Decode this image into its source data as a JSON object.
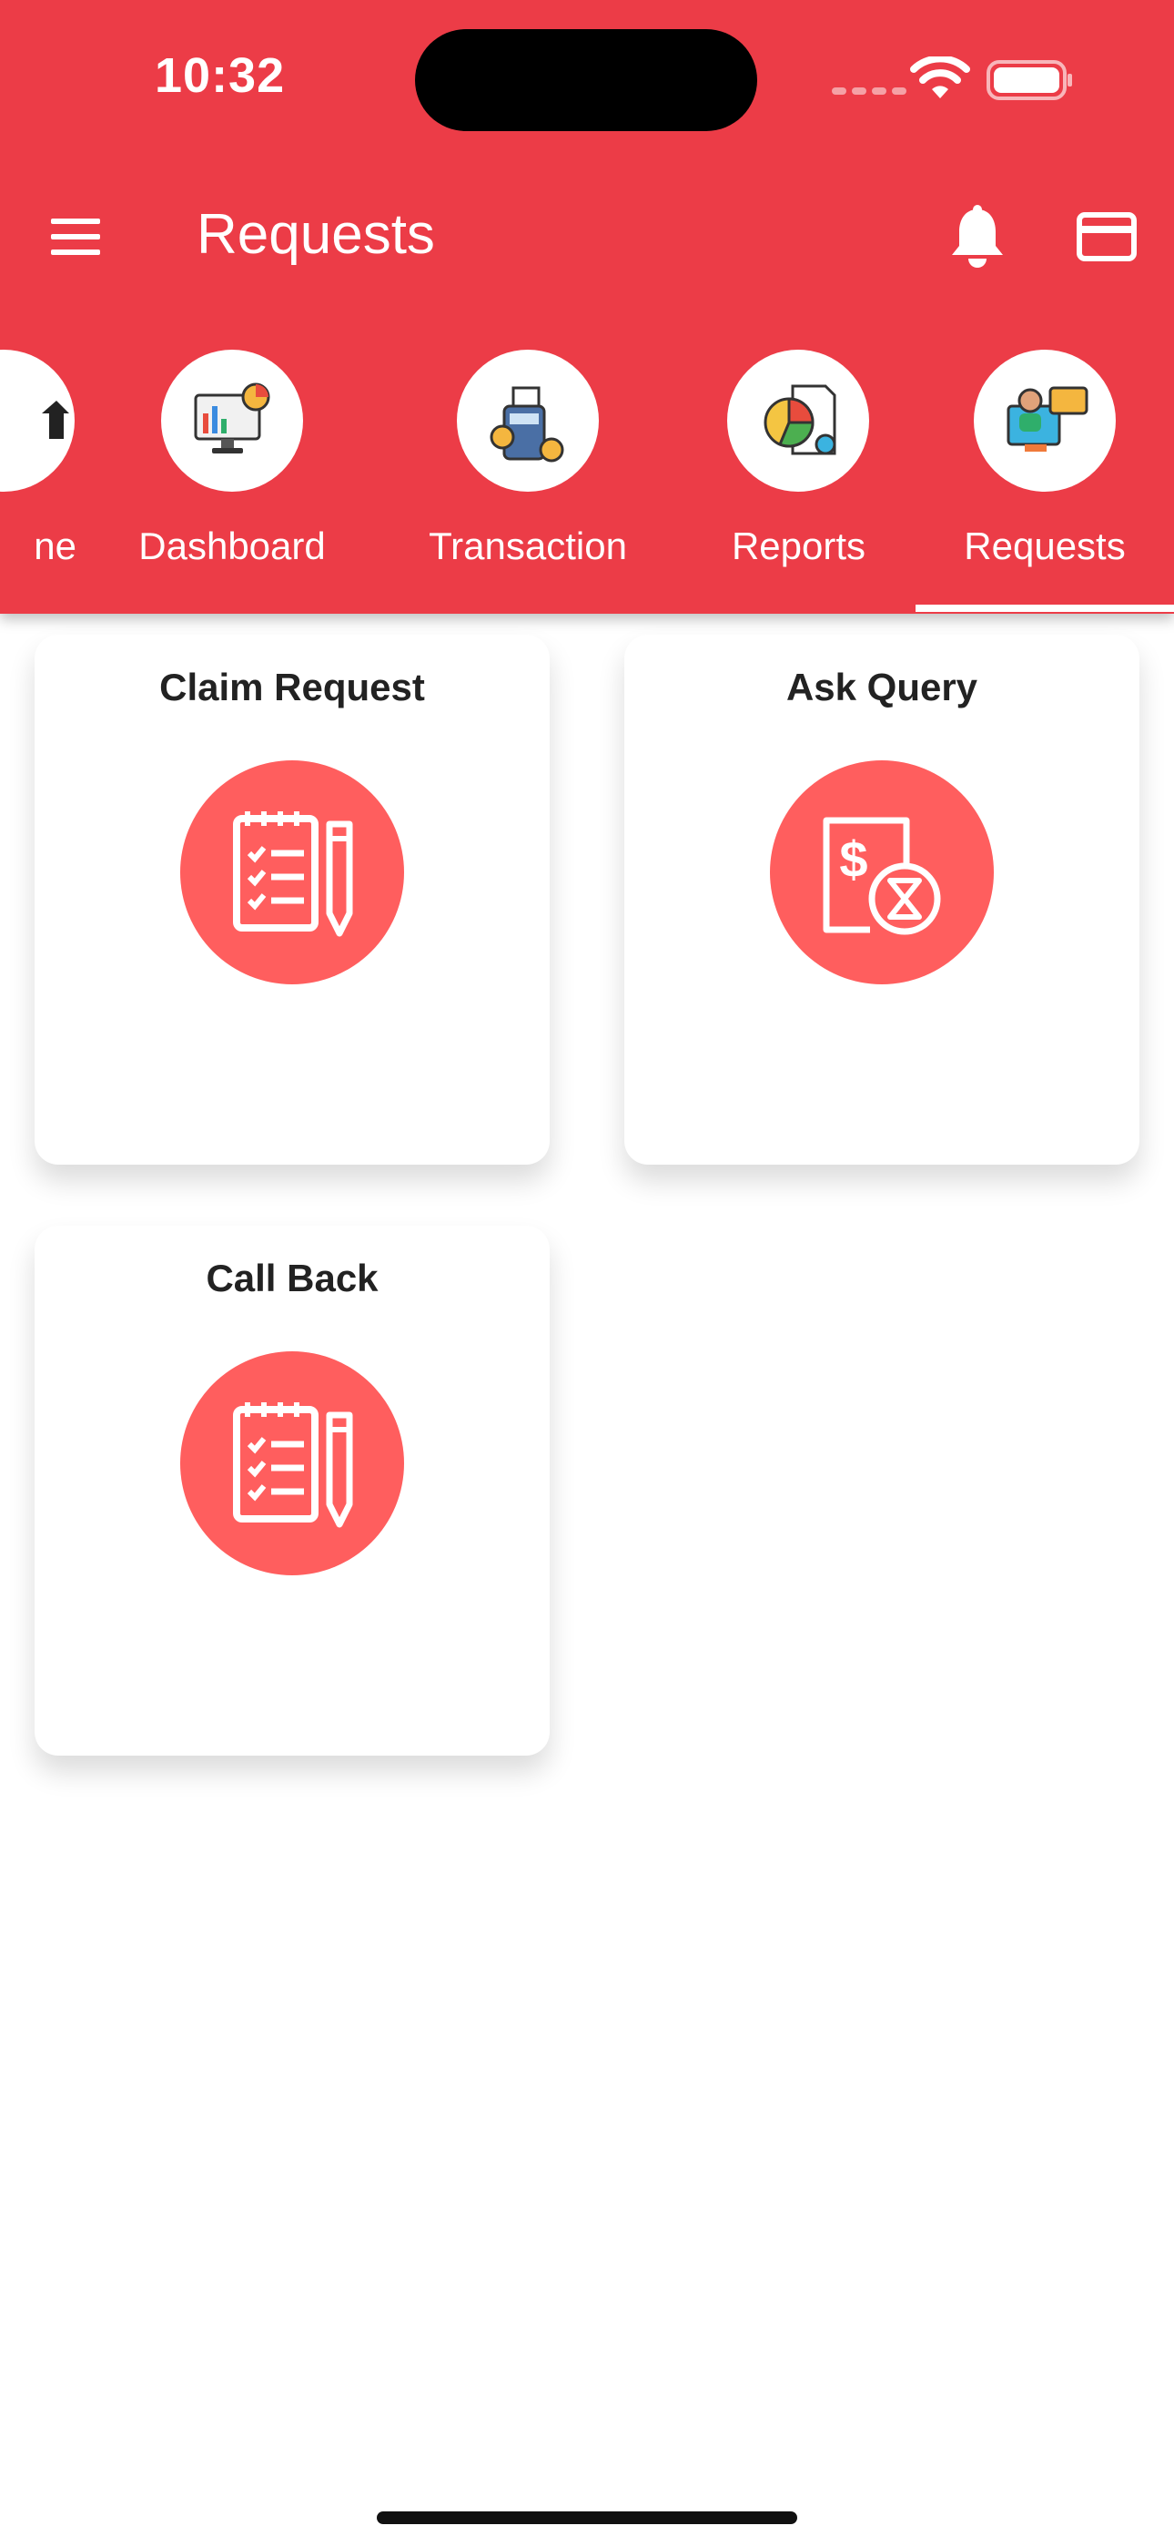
{
  "status": {
    "time": "10:32"
  },
  "header": {
    "title": "Requests"
  },
  "tabs": [
    {
      "label": "ne",
      "icon": "home-icon"
    },
    {
      "label": "Dashboard",
      "icon": "dashboard-icon"
    },
    {
      "label": "Transaction",
      "icon": "transaction-icon"
    },
    {
      "label": "Reports",
      "icon": "reports-icon"
    },
    {
      "label": "Requests",
      "icon": "requests-icon",
      "selected": true
    }
  ],
  "cards": [
    {
      "title": "Claim Request",
      "icon": "checklist-pencil-icon"
    },
    {
      "title": "Ask Query",
      "icon": "dollar-hourglass-icon"
    },
    {
      "title": "Call Back",
      "icon": "checklist-pencil-icon"
    }
  ],
  "colors": {
    "primary": "#ec3c47",
    "icon_bg": "#ff5e5e"
  }
}
